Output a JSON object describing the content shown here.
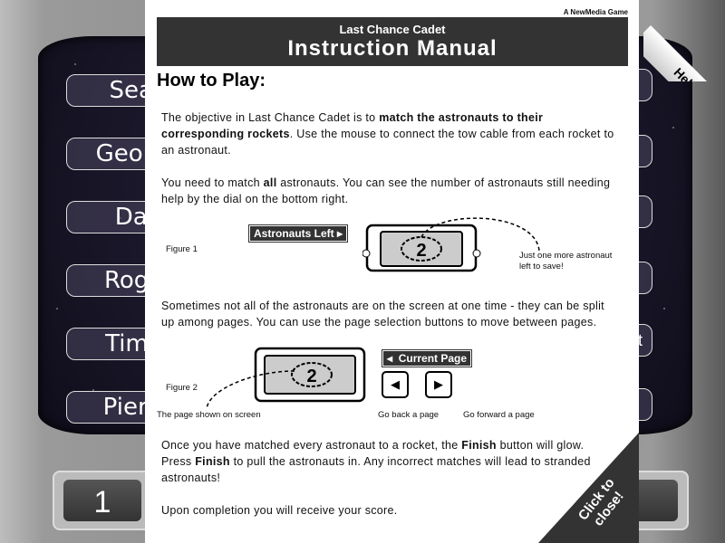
{
  "background": {
    "astronaut_names": [
      "Sean",
      "George",
      "Dan",
      "Roger",
      "Timot",
      "Pierce"
    ],
    "rocket_labels": [
      "",
      "",
      "",
      "",
      "t",
      ""
    ],
    "dial_left_value": "1"
  },
  "modal": {
    "credit": "A NewMedia Game",
    "subtitle": "Last Chance Cadet",
    "title": "Instruction Manual",
    "section_heading": "How to Play:",
    "p1": {
      "a": "The objective in Last Chance Cadet is to ",
      "b": "match the astronauts to their corresponding rockets",
      "c": ". Use the mouse to connect the tow cable from each rocket to an astronaut."
    },
    "p2": {
      "a": "You need to match ",
      "b": "all",
      "c": " astronauts. You can see the number of astronauts still needing help by the dial on the bottom right."
    },
    "figure1": {
      "label": "Figure 1",
      "tag": "Astronauts Left",
      "dial_value": "2",
      "note": "Just one more astronaut left to save!"
    },
    "p3": "Sometimes not all of the astronauts are on the screen at one time - they can be split up among pages. You can use the page selection buttons to move between pages.",
    "figure2": {
      "label": "Figure 2",
      "tag": "Current Page",
      "dial_value": "2",
      "note_page": "The page shown on screen",
      "note_back": "Go back a page",
      "note_forward": "Go forward a page"
    },
    "p4": {
      "a": "Once you have matched every astronaut to a rocket, the ",
      "b": "Finish",
      "c": " button will glow. Press ",
      "d": "Finish",
      "e": " to pull the astronauts in. Any incorrect matches will lead to stranded astronauts!"
    },
    "p5": "Upon completion you will receive your score.",
    "close_label": "Click to close!"
  },
  "help_label": "Help"
}
